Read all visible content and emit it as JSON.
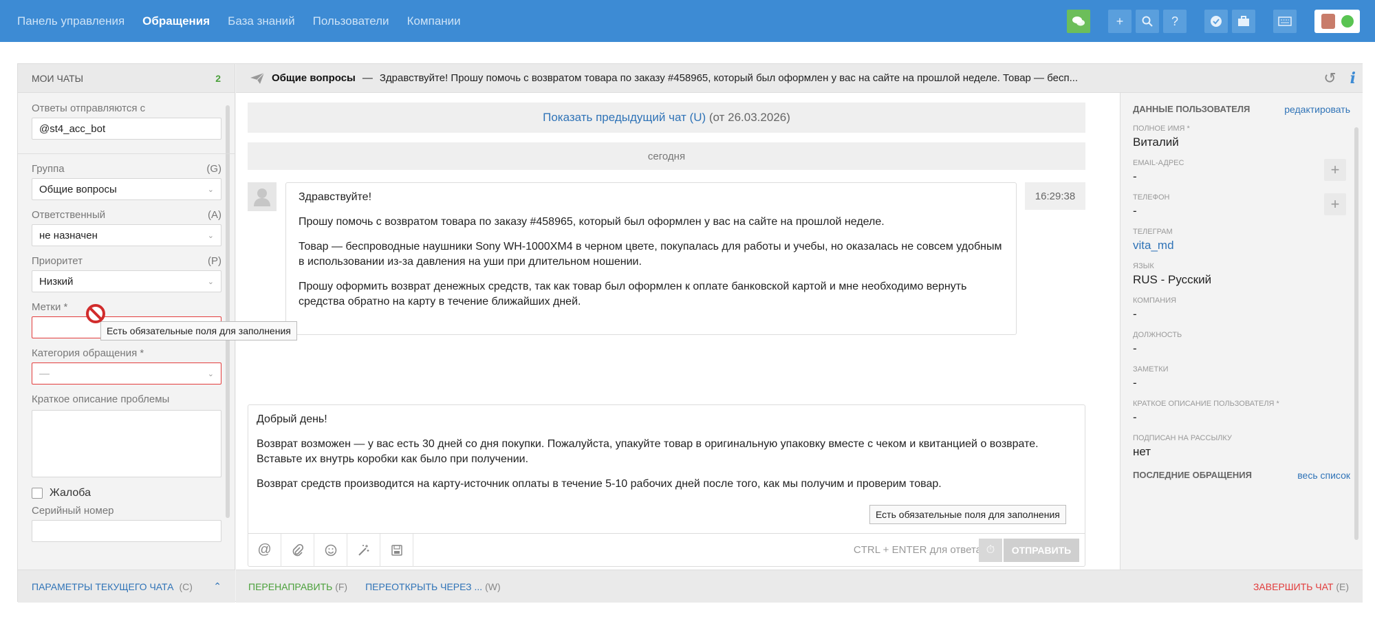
{
  "nav": {
    "items": [
      "Панель управления",
      "Обращения",
      "База знаний",
      "Пользователи",
      "Компании"
    ],
    "active_index": 1
  },
  "top_icons": [
    "chat-icon",
    "plus-icon",
    "search-icon",
    "help-icon",
    "check-icon",
    "briefcase-icon",
    "keyboard-icon"
  ],
  "left": {
    "header": "МОИ ЧАТЫ",
    "count": "2",
    "sender_label": "Ответы отправляются с",
    "sender_value": "@st4_acc_bot",
    "group_label": "Группа",
    "group_key": "(G)",
    "group_value": "Общие вопросы",
    "assignee_label": "Ответственный",
    "assignee_key": "(A)",
    "assignee_value": "не назначен",
    "priority_label": "Приоритет",
    "priority_key": "(P)",
    "priority_value": "Низкий",
    "tags_label": "Метки *",
    "category_label": "Категория обращения *",
    "category_value": "—",
    "summary_label": "Краткое описание проблемы",
    "complaint_label": "Жалоба",
    "serial_label": "Серийный номер",
    "footer_label": "ПАРАМЕТРЫ ТЕКУЩЕГО ЧАТА",
    "footer_key": "(C)"
  },
  "chat": {
    "header_title": "Общие вопросы",
    "header_dash": "—",
    "header_preview": "Здравствуйте! Прошу помочь с возвратом товара по заказу #458965, который был оформлен у вас на сайте на прошлой неделе. Товар — бесп...",
    "prev_chat_link": "Показать предыдущий чат (U)",
    "prev_chat_date": "(от 26.03.2026)",
    "today_label": "сегодня",
    "message_paragraphs": [
      "Здравствуйте!",
      "Прошу помочь с возвратом товара по заказу #458965, который был оформлен у вас на сайте на прошлой неделе.",
      "Товар — беспроводные наушники Sony WH-1000XM4 в черном цвете, покупалась для работы и учебы, но оказалась не совсем удобным в использовании из-за давления на уши при длительном ношении.",
      "Прошу оформить возврат денежных средств, так как товар был оформлен к оплате банковской картой и мне необходимо вернуть средства обратно на карту в течение ближайших дней."
    ],
    "message_time": "16:29:38",
    "reply_paragraphs": [
      "Добрый день!",
      "Возврат возможен — у вас есть 30 дней со дня покупки. Пожалуйста, упакуйте товар в оригинальную упаковку вместе с чеком и квитанцией о возврате. Вставьте их внутрь коробки как было при получении.",
      "Возврат средств производится на карту-источник оплаты в течение 5-10 рабочих дней после того, как мы получим и проверим товар."
    ],
    "hint": "CTRL + ENTER для ответа",
    "send_label": "ОТПРАВИТЬ",
    "tooltip": "Есть обязательные поля для заполнения"
  },
  "footer": {
    "redirect_label": "ПЕРЕНАПРАВИТЬ",
    "redirect_key": "(F)",
    "reopen_label": "ПЕРЕОТКРЫТЬ ЧЕРЕЗ ...",
    "reopen_key": "(W)",
    "end_label": "ЗАВЕРШИТЬ ЧАТ",
    "end_key": "(E)"
  },
  "user": {
    "header": "ДАННЫЕ ПОЛЬЗОВАТЕЛЯ",
    "edit_link": "редактировать",
    "fullname_label": "ПОЛНОЕ ИМЯ *",
    "fullname": "Виталий",
    "email_label": "EMAIL-АДРЕС",
    "email": "-",
    "phone_label": "ТЕЛЕФОН",
    "phone": "-",
    "telegram_label": "ТЕЛЕГРАМ",
    "telegram": "vita_md",
    "lang_label": "ЯЗЫК",
    "lang": "RUS - Русский",
    "company_label": "КОМПАНИЯ",
    "company": "-",
    "position_label": "ДОЛЖНОСТЬ",
    "position": "-",
    "notes_label": "ЗАМЕТКИ",
    "notes": "-",
    "desc_label": "КРАТКОЕ ОПИСАНИЕ ПОЛЬЗОВАТЕЛЯ *",
    "desc": "-",
    "newsletter_label": "ПОДПИСАН НА РАССЫЛКУ",
    "newsletter": "нет",
    "recent_label": "ПОСЛЕДНИЕ ОБРАЩЕНИЯ",
    "all_link": "весь список"
  }
}
